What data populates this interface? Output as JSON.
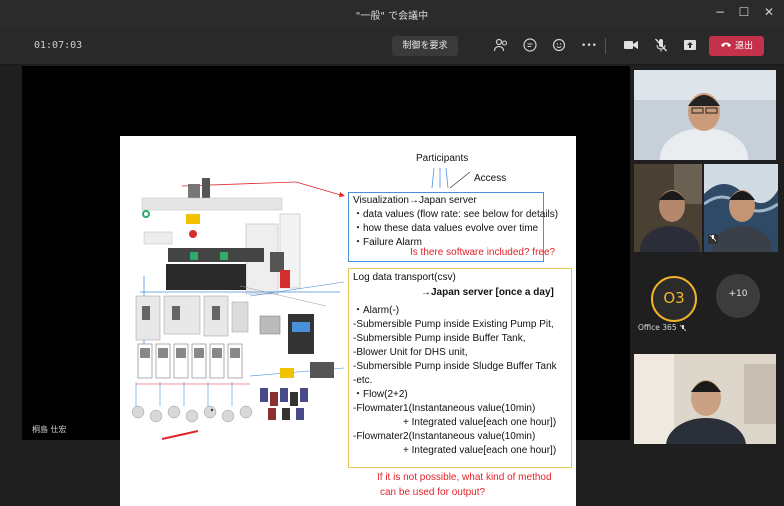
{
  "window": {
    "title": "\"一般\" で会議中",
    "minimize_glyph": "−",
    "maximize_glyph": "☐",
    "close_glyph": "✕"
  },
  "toolbar": {
    "timer": "01:07:03",
    "request_control_label": "制御を要求",
    "leave_label": "退出",
    "icons": [
      "people-icon",
      "chat-icon",
      "reactions-icon",
      "more-icon",
      "camera-icon",
      "mic-off-icon",
      "share-icon",
      "phone-hangup-icon"
    ],
    "more_glyph": "•••"
  },
  "slide": {
    "participants_label": "Participants",
    "access_label": "Access",
    "box1_lines": [
      "Visualization→Japan server",
      "・data values (flow rate: see below for details)",
      "・how these data values evolve over time",
      "・Failure Alarm"
    ],
    "question1": "Is there software included? free?",
    "box2_title": "Log data transport(csv)",
    "box2_subtitle": "→Japan server [once a day]",
    "box2_lines": [
      "・Alarm(-)",
      "-Submersible Pump inside Existing Pump Pit,",
      "-Submersible Pump inside Buffer Tank,",
      "-Blower Unit for DHS unit,",
      "-Submersible Pump inside Sludge Buffer Tank",
      "-etc.",
      "・Flow(2+2)",
      "-Flowmater1(Instantaneous value(10min)",
      "+ Integrated value[each one hour])",
      "-Flowmater2(Instantaneous value(10min)",
      "+ Integrated value[each one hour])"
    ],
    "question2_lines": [
      "If it is not possible, what kind of method",
      "can be used for output?"
    ]
  },
  "presenter_name": "桐島 仕宏",
  "participants": {
    "avatar_initials": "O3",
    "avatar_name": "Office 365",
    "avatar_color": "#f0b429",
    "overflow_count": "+10"
  },
  "colors": {
    "leave_button": "#c4314b",
    "box1_border": "#4a90d9",
    "box2_border": "#e8c35a",
    "question_text": "#e0232a"
  }
}
